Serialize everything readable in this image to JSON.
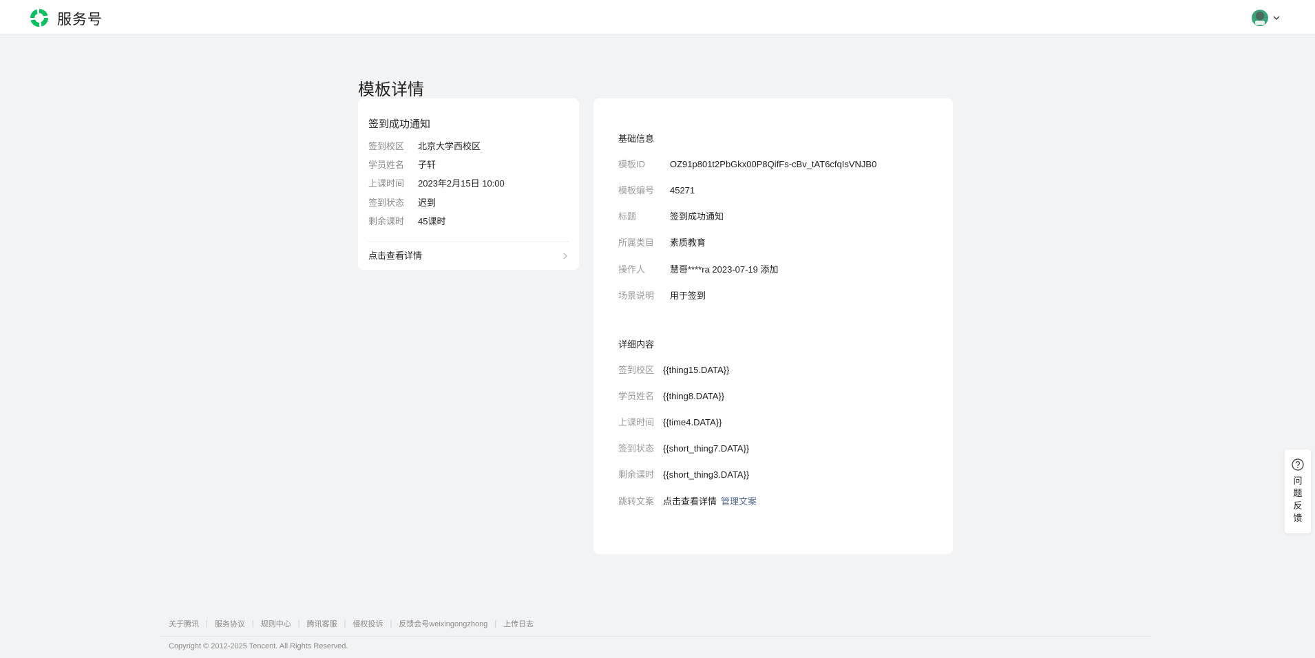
{
  "header": {
    "brand": "服务号",
    "logo_icon": "weixin-service-logo-icon",
    "avatar_icon": "user-avatar",
    "dropdown_icon": "chevron-down-icon"
  },
  "page_title": "模板详情",
  "preview": {
    "title": "签到成功通知",
    "rows": [
      {
        "label": "签到校区",
        "value": "北京大学西校区"
      },
      {
        "label": "学员姓名",
        "value": "子轩"
      },
      {
        "label": "上课时间",
        "value": "2023年2月15日 10:00"
      },
      {
        "label": "签到状态",
        "value": "迟到"
      },
      {
        "label": "剩余课时",
        "value": "45课时"
      }
    ],
    "link_label": "点击查看详情"
  },
  "basic_info": {
    "section_title": "基础信息",
    "rows": [
      {
        "label": "模板ID",
        "value": "OZ91p801t2PbGkx00P8QifFs-cBv_tAT6cfqIsVNJB0"
      },
      {
        "label": "模板编号",
        "value": "45271"
      },
      {
        "label": "标题",
        "value": "签到成功通知"
      },
      {
        "label": "所属类目",
        "value": "素质教育"
      },
      {
        "label": "操作人",
        "value": "慧哥****ra 2023-07-19 添加"
      },
      {
        "label": "场景说明",
        "value": "用于签到"
      }
    ]
  },
  "detail_content": {
    "section_title": "详细内容",
    "rows": [
      {
        "label": "签到校区",
        "value": "{{thing15.DATA}}"
      },
      {
        "label": "学员姓名",
        "value": "{{thing8.DATA}}"
      },
      {
        "label": "上课时间",
        "value": "{{time4.DATA}}"
      },
      {
        "label": "签到状态",
        "value": "{{short_thing7.DATA}}"
      },
      {
        "label": "剩余课时",
        "value": "{{short_thing3.DATA}}"
      }
    ],
    "jump": {
      "label": "跳转文案",
      "value": "点击查看详情",
      "action": "管理文案"
    }
  },
  "feedback": {
    "label": "问题反馈",
    "icon": "question-circle-icon"
  },
  "footer": {
    "links": [
      "关于腾讯",
      "服务协议",
      "规则中心",
      "腾讯客服",
      "侵权投诉",
      "反馈会号weixingongzhong",
      "上传日志"
    ],
    "copyright": "Copyright © 2012-2025 Tencent. All Rights Reserved."
  },
  "colors": {
    "brand_green": "#07c160",
    "link_blue": "#576b95",
    "bg": "#f2f3f5"
  }
}
